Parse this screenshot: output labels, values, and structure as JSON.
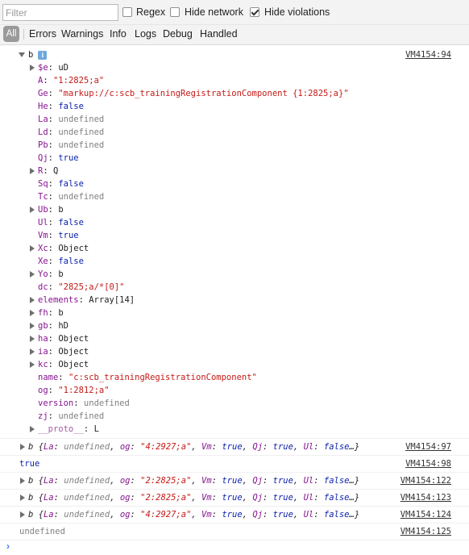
{
  "toolbar": {
    "filter_placeholder": "Filter",
    "regex_label": "Regex",
    "regex_checked": false,
    "hide_network_label": "Hide network",
    "hide_network_checked": false,
    "hide_violations_label": "Hide violations",
    "hide_violations_checked": true
  },
  "levels": {
    "all": "All",
    "items": [
      "Errors",
      "Warnings",
      "Info",
      "Logs",
      "Debug",
      "Handled"
    ]
  },
  "root_object": {
    "name": "b",
    "badge": "i",
    "source": "VM4154:94",
    "properties": [
      {
        "key": "$e",
        "sep": ": ",
        "value": "uD",
        "type": "obj",
        "expandable": true
      },
      {
        "key": "A",
        "sep": ": ",
        "value": "\"1:2825;a\"",
        "type": "str",
        "expandable": false
      },
      {
        "key": "Ge",
        "sep": ": ",
        "value": "\"markup://c:scb_trainingRegistrationComponent {1:2825;a}\"",
        "type": "str",
        "expandable": false
      },
      {
        "key": "He",
        "sep": ": ",
        "value": "false",
        "type": "kw",
        "expandable": false
      },
      {
        "key": "La",
        "sep": ": ",
        "value": "undefined",
        "type": "undef",
        "expandable": false
      },
      {
        "key": "Ld",
        "sep": ": ",
        "value": "undefined",
        "type": "undef",
        "expandable": false
      },
      {
        "key": "Pb",
        "sep": ": ",
        "value": "undefined",
        "type": "undef",
        "expandable": false
      },
      {
        "key": "Qj",
        "sep": ": ",
        "value": "true",
        "type": "kw",
        "expandable": false
      },
      {
        "key": "R",
        "sep": ": ",
        "value": "Q",
        "type": "obj",
        "expandable": true
      },
      {
        "key": "Sq",
        "sep": ": ",
        "value": "false",
        "type": "kw",
        "expandable": false
      },
      {
        "key": "Tc",
        "sep": ": ",
        "value": "undefined",
        "type": "undef",
        "expandable": false
      },
      {
        "key": "Ub",
        "sep": ": ",
        "value": "b",
        "type": "obj",
        "expandable": true
      },
      {
        "key": "Ul",
        "sep": ": ",
        "value": "false",
        "type": "kw",
        "expandable": false
      },
      {
        "key": "Vm",
        "sep": ": ",
        "value": "true",
        "type": "kw",
        "expandable": false
      },
      {
        "key": "Xc",
        "sep": ": ",
        "value": "Object",
        "type": "obj",
        "expandable": true
      },
      {
        "key": "Xe",
        "sep": ": ",
        "value": "false",
        "type": "kw",
        "expandable": false
      },
      {
        "key": "Yo",
        "sep": ": ",
        "value": "b",
        "type": "obj",
        "expandable": true
      },
      {
        "key": "dc",
        "sep": ": ",
        "value": "\"2825;a/*[0]\"",
        "type": "str",
        "expandable": false
      },
      {
        "key": "elements",
        "sep": ": ",
        "value": "Array[14]",
        "type": "obj",
        "expandable": true
      },
      {
        "key": "fh",
        "sep": ": ",
        "value": "b",
        "type": "obj",
        "expandable": true
      },
      {
        "key": "gb",
        "sep": ": ",
        "value": "hD",
        "type": "obj",
        "expandable": true
      },
      {
        "key": "ha",
        "sep": ": ",
        "value": "Object",
        "type": "obj",
        "expandable": true
      },
      {
        "key": "ia",
        "sep": ": ",
        "value": "Object",
        "type": "obj",
        "expandable": true
      },
      {
        "key": "kc",
        "sep": ": ",
        "value": "Object",
        "type": "obj",
        "expandable": true
      },
      {
        "key": "name",
        "sep": ": ",
        "value": "\"c:scb_trainingRegistrationComponent\"",
        "type": "str",
        "expandable": false
      },
      {
        "key": "og",
        "sep": ": ",
        "value": "\"1:2812;a\"",
        "type": "str",
        "expandable": false
      },
      {
        "key": "version",
        "sep": ": ",
        "value": "undefined",
        "type": "undef",
        "expandable": false
      },
      {
        "key": "zj",
        "sep": ": ",
        "value": "undefined",
        "type": "undef",
        "expandable": false
      },
      {
        "key": "__proto__",
        "sep": ": ",
        "value": "L",
        "type": "obj",
        "expandable": true,
        "dim": true
      }
    ]
  },
  "messages": [
    {
      "kind": "object",
      "name": "b",
      "summary": [
        {
          "t": "p",
          "v": " {"
        },
        {
          "t": "key",
          "v": "La"
        },
        {
          "t": "p",
          "v": ": "
        },
        {
          "t": "undef",
          "v": "undefined"
        },
        {
          "t": "p",
          "v": ", "
        },
        {
          "t": "key",
          "v": "og"
        },
        {
          "t": "p",
          "v": ": "
        },
        {
          "t": "str",
          "v": "\"4:2927;a\""
        },
        {
          "t": "p",
          "v": ", "
        },
        {
          "t": "key",
          "v": "Vm"
        },
        {
          "t": "p",
          "v": ": "
        },
        {
          "t": "kw",
          "v": "true"
        },
        {
          "t": "p",
          "v": ", "
        },
        {
          "t": "key",
          "v": "Qj"
        },
        {
          "t": "p",
          "v": ": "
        },
        {
          "t": "kw",
          "v": "true"
        },
        {
          "t": "p",
          "v": ", "
        },
        {
          "t": "key",
          "v": "Ul"
        },
        {
          "t": "p",
          "v": ": "
        },
        {
          "t": "kw",
          "v": "false"
        },
        {
          "t": "p",
          "v": "…}"
        }
      ],
      "source": "VM4154:97"
    },
    {
      "kind": "text",
      "text": "true",
      "type": "kw",
      "source": "VM4154:98"
    },
    {
      "kind": "object",
      "name": "b",
      "summary": [
        {
          "t": "p",
          "v": " {"
        },
        {
          "t": "key",
          "v": "La"
        },
        {
          "t": "p",
          "v": ": "
        },
        {
          "t": "undef",
          "v": "undefined"
        },
        {
          "t": "p",
          "v": ", "
        },
        {
          "t": "key",
          "v": "og"
        },
        {
          "t": "p",
          "v": ": "
        },
        {
          "t": "str",
          "v": "\"2:2825;a\""
        },
        {
          "t": "p",
          "v": ", "
        },
        {
          "t": "key",
          "v": "Vm"
        },
        {
          "t": "p",
          "v": ": "
        },
        {
          "t": "kw",
          "v": "true"
        },
        {
          "t": "p",
          "v": ", "
        },
        {
          "t": "key",
          "v": "Qj"
        },
        {
          "t": "p",
          "v": ": "
        },
        {
          "t": "kw",
          "v": "true"
        },
        {
          "t": "p",
          "v": ", "
        },
        {
          "t": "key",
          "v": "Ul"
        },
        {
          "t": "p",
          "v": ": "
        },
        {
          "t": "kw",
          "v": "false"
        },
        {
          "t": "p",
          "v": "…}"
        }
      ],
      "source": "VM4154:122"
    },
    {
      "kind": "object",
      "name": "b",
      "summary": [
        {
          "t": "p",
          "v": " {"
        },
        {
          "t": "key",
          "v": "La"
        },
        {
          "t": "p",
          "v": ": "
        },
        {
          "t": "undef",
          "v": "undefined"
        },
        {
          "t": "p",
          "v": ", "
        },
        {
          "t": "key",
          "v": "og"
        },
        {
          "t": "p",
          "v": ": "
        },
        {
          "t": "str",
          "v": "\"2:2825;a\""
        },
        {
          "t": "p",
          "v": ", "
        },
        {
          "t": "key",
          "v": "Vm"
        },
        {
          "t": "p",
          "v": ": "
        },
        {
          "t": "kw",
          "v": "true"
        },
        {
          "t": "p",
          "v": ", "
        },
        {
          "t": "key",
          "v": "Qj"
        },
        {
          "t": "p",
          "v": ": "
        },
        {
          "t": "kw",
          "v": "true"
        },
        {
          "t": "p",
          "v": ", "
        },
        {
          "t": "key",
          "v": "Ul"
        },
        {
          "t": "p",
          "v": ": "
        },
        {
          "t": "kw",
          "v": "false"
        },
        {
          "t": "p",
          "v": "…}"
        }
      ],
      "source": "VM4154:123"
    },
    {
      "kind": "object",
      "name": "b",
      "summary": [
        {
          "t": "p",
          "v": " {"
        },
        {
          "t": "key",
          "v": "La"
        },
        {
          "t": "p",
          "v": ": "
        },
        {
          "t": "undef",
          "v": "undefined"
        },
        {
          "t": "p",
          "v": ", "
        },
        {
          "t": "key",
          "v": "og"
        },
        {
          "t": "p",
          "v": ": "
        },
        {
          "t": "str",
          "v": "\"4:2927;a\""
        },
        {
          "t": "p",
          "v": ", "
        },
        {
          "t": "key",
          "v": "Vm"
        },
        {
          "t": "p",
          "v": ": "
        },
        {
          "t": "kw",
          "v": "true"
        },
        {
          "t": "p",
          "v": ", "
        },
        {
          "t": "key",
          "v": "Qj"
        },
        {
          "t": "p",
          "v": ": "
        },
        {
          "t": "kw",
          "v": "true"
        },
        {
          "t": "p",
          "v": ", "
        },
        {
          "t": "key",
          "v": "Ul"
        },
        {
          "t": "p",
          "v": ": "
        },
        {
          "t": "kw",
          "v": "false"
        },
        {
          "t": "p",
          "v": "…}"
        }
      ],
      "source": "VM4154:124"
    },
    {
      "kind": "text",
      "text": "undefined",
      "type": "undef",
      "source": "VM4154:125"
    }
  ],
  "prompt_glyph": "›"
}
